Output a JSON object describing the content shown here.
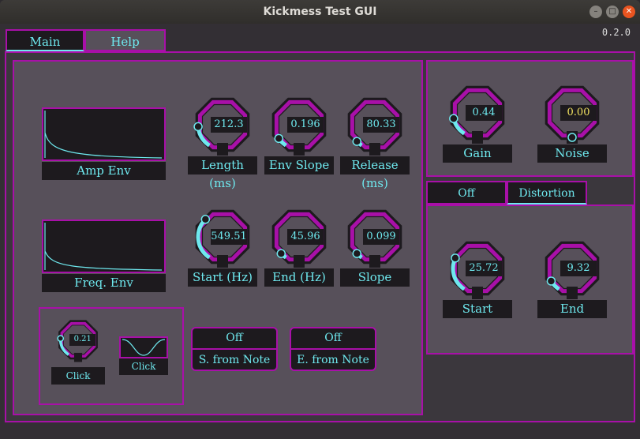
{
  "window": {
    "title": "Kickmess Test GUI"
  },
  "version": "0.2.0",
  "tabs": [
    {
      "label": "Main"
    },
    {
      "label": "Help"
    }
  ],
  "envelopes": {
    "amp": {
      "label": "Amp Env"
    },
    "freq": {
      "label": "Freq. Env"
    }
  },
  "knobs": {
    "length": {
      "value": "212.3",
      "label": "Length (ms)",
      "level": 0.18
    },
    "env_slope": {
      "value": "0.196",
      "label": "Env Slope",
      "level": 0.08
    },
    "release": {
      "value": "80.33",
      "label": "Release (ms)",
      "level": 0.05
    },
    "start_hz": {
      "value": "549.51",
      "label": "Start (Hz)",
      "level": 0.35
    },
    "end_hz": {
      "value": "45.96",
      "label": "End (Hz)",
      "level": 0.05
    },
    "slope": {
      "value": "0.099",
      "label": "Slope",
      "level": 0.05
    },
    "click": {
      "value": "0.21",
      "label": "Click",
      "level": 0.21
    },
    "gain": {
      "value": "0.44",
      "label": "Gain",
      "level": 0.15
    },
    "noise": {
      "value": "0.00",
      "label": "Noise",
      "level": 0.0
    },
    "dist_start": {
      "value": "25.72",
      "label": "Start",
      "level": 0.28
    },
    "dist_end": {
      "value": "9.32",
      "label": "End",
      "level": 0.09
    }
  },
  "click_shape": {
    "label": "Click"
  },
  "toggles": {
    "start_from_note": {
      "state": "Off",
      "label": "S. from Note"
    },
    "end_from_note": {
      "state": "Off",
      "label": "E. from Note"
    }
  },
  "distortion": {
    "toggle": "Off",
    "label": "Distortion"
  },
  "colors": {
    "accent": "#a810a8",
    "value": "#6ee8ee",
    "noise_value": "#f0e060",
    "bg": "#57505a"
  }
}
